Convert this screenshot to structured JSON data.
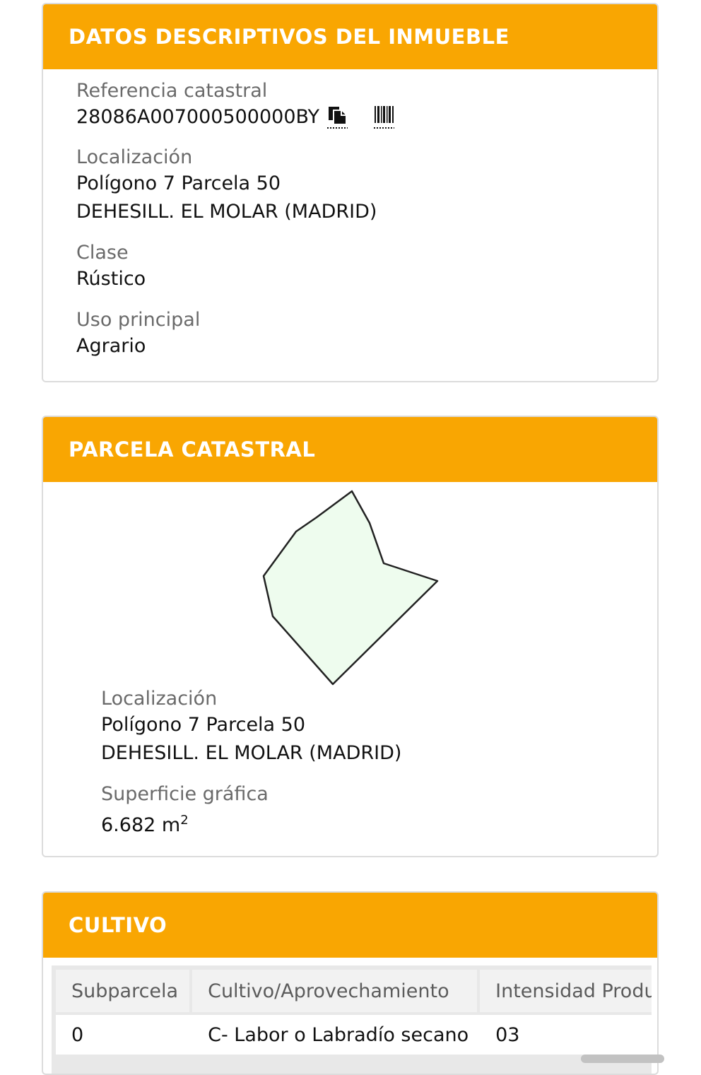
{
  "descriptive": {
    "title": "DATOS DESCRIPTIVOS DEL INMUEBLE",
    "ref_label": "Referencia catastral",
    "ref_value": "28086A007000500000BY",
    "copy_icon": "copy-icon",
    "barcode_icon": "barcode-icon",
    "loc_label": "Localización",
    "loc_line1": "Polígono 7 Parcela 50",
    "loc_line2": "DEHESILL. EL MOLAR (MADRID)",
    "class_label": "Clase",
    "class_value": "Rústico",
    "use_label": "Uso principal",
    "use_value": "Agrario"
  },
  "parcel": {
    "title": "PARCELA CATASTRAL",
    "fill_color": "#eefcee",
    "loc_label": "Localización",
    "loc_line1": "Polígono 7 Parcela 50",
    "loc_line2": "DEHESILL. EL MOLAR (MADRID)",
    "surface_label": "Superficie gráfica",
    "surface_value": "6.682 m",
    "surface_unit_sup": "2"
  },
  "cultivo": {
    "title": "CULTIVO",
    "headers": [
      "Subparcela",
      "Cultivo/Aprovechamiento",
      "Intensidad Productiva"
    ],
    "rows": [
      [
        "0",
        "C- Labor o Labradío secano",
        "03"
      ]
    ]
  },
  "colors": {
    "header_bg": "#f9a602",
    "header_text": "#ffffff"
  }
}
